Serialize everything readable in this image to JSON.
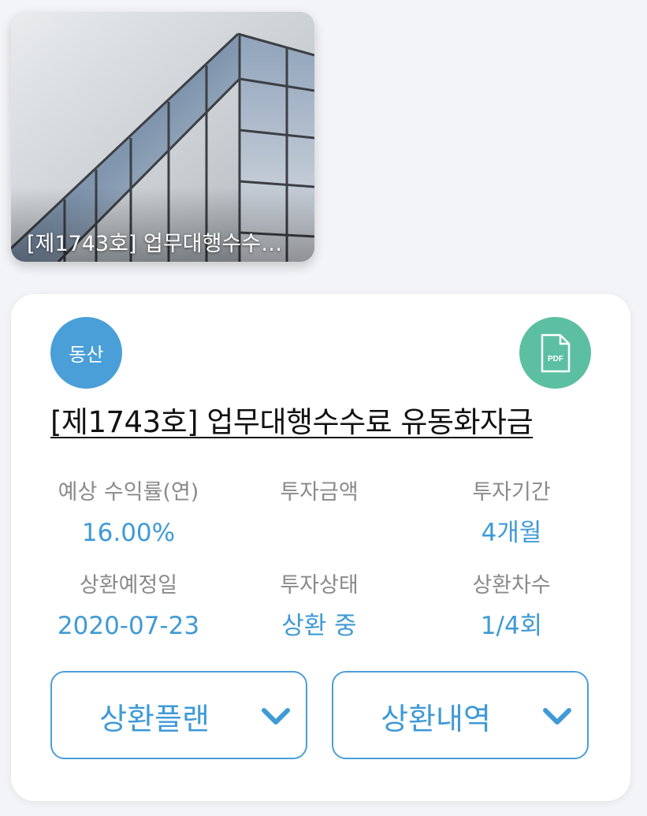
{
  "thumbnail": {
    "caption": "[제1743호] 업무대행수수…"
  },
  "product": {
    "category_badge": "동산",
    "pdf_label": "PDF",
    "title": "[제1743호] 업무대행수수료 유동화자금"
  },
  "stats": [
    {
      "label": "예상 수익률(연)",
      "value": "16.00%"
    },
    {
      "label": "투자금액",
      "value": ""
    },
    {
      "label": "투자기간",
      "value": "4개월"
    },
    {
      "label": "상환예정일",
      "value": "2020-07-23"
    },
    {
      "label": "투자상태",
      "value": "상환 중"
    },
    {
      "label": "상환차수",
      "value": "1/4회"
    }
  ],
  "buttons": {
    "repayment_plan": "상환플랜",
    "repayment_history": "상환내역"
  },
  "colors": {
    "accent": "#3f9ad6",
    "category_badge": "#4a9fd8",
    "pdf_badge": "#5cbfa2"
  },
  "icons": {
    "pdf": "pdf-file-icon",
    "chevron": "chevron-down-icon"
  }
}
